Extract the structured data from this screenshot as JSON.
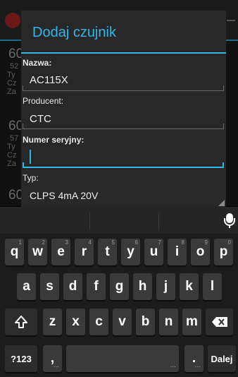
{
  "background": {
    "items": [
      {
        "big": "60",
        "line1": "52",
        "line2": "Ty",
        "line3": "Cz",
        "line4": "Za"
      },
      {
        "big": "60",
        "line1": "57",
        "line2": "Ty",
        "line3": "Cz",
        "line4": "Za"
      },
      {
        "big": "60"
      }
    ]
  },
  "dialog": {
    "title": "Dodaj czujnik",
    "fields": {
      "name_label": "Nazwa:",
      "name_value": "AC115X",
      "producer_label": "Producent:",
      "producer_value": "CTC",
      "serial_label": "Numer seryjny:",
      "serial_value": "",
      "type_label": "Typ:",
      "type_value": "CLPS 4mA 20V"
    }
  },
  "keyboard": {
    "row1": [
      {
        "k": "q",
        "h": "1"
      },
      {
        "k": "w",
        "h": "2"
      },
      {
        "k": "e",
        "h": "3"
      },
      {
        "k": "r",
        "h": "4"
      },
      {
        "k": "t",
        "h": "5"
      },
      {
        "k": "y",
        "h": "6"
      },
      {
        "k": "u",
        "h": "7"
      },
      {
        "k": "i",
        "h": "8"
      },
      {
        "k": "o",
        "h": "9"
      },
      {
        "k": "p",
        "h": "0"
      }
    ],
    "row2": [
      "a",
      "s",
      "d",
      "f",
      "g",
      "h",
      "j",
      "k",
      "l"
    ],
    "row3": [
      "z",
      "x",
      "c",
      "v",
      "b",
      "n",
      "m"
    ],
    "symbols_label": "?123",
    "comma": ",",
    "period": ".",
    "enter_label": "Dalej",
    "shift_icon": "shift-arrow-icon",
    "backspace_icon": "backspace-icon",
    "mic_icon": "microphone-icon"
  }
}
